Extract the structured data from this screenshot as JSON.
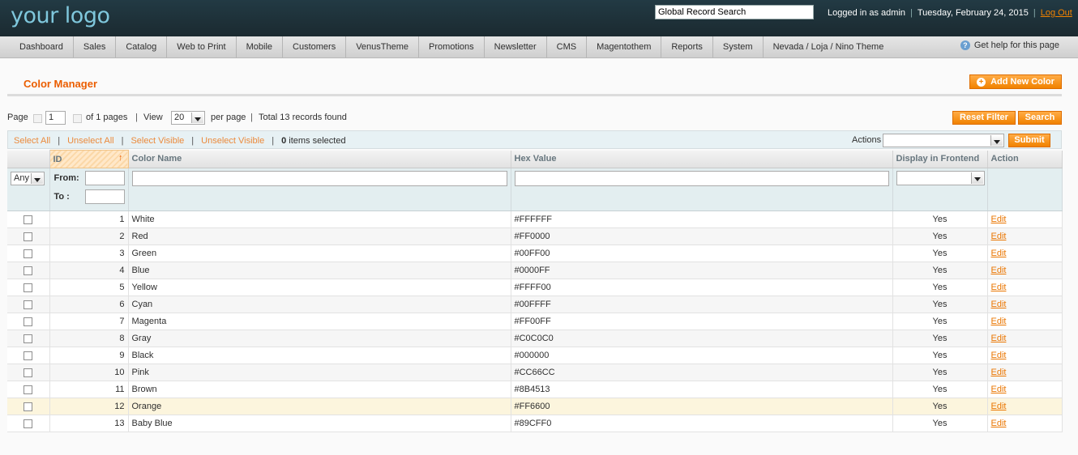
{
  "header": {
    "logo": "your logo",
    "global_search_placeholder": "Global Record Search",
    "logged_in": "Logged in as admin",
    "date": "Tuesday, February 24, 2015",
    "logout": "Log Out"
  },
  "nav": {
    "items": [
      "Dashboard",
      "Sales",
      "Catalog",
      "Web to Print",
      "Mobile",
      "Customers",
      "VenusTheme",
      "Promotions",
      "Newsletter",
      "CMS",
      "Magentothem",
      "Reports",
      "System",
      "Nevada / Loja / Nino Theme"
    ],
    "help": "Get help for this page"
  },
  "page": {
    "title": "Color Manager",
    "add_button": "Add New Color",
    "reset_filter": "Reset Filter",
    "search": "Search"
  },
  "pager": {
    "page_label": "Page",
    "page_value": "1",
    "of_pages": "of 1 pages",
    "view_label": "View",
    "per_page_value": "20",
    "per_page_label": "per page",
    "total": "Total 13 records found"
  },
  "massaction": {
    "select_all": "Select All",
    "unselect_all": "Unselect All",
    "select_visible": "Select Visible",
    "unselect_visible": "Unselect Visible",
    "selected_count": "0",
    "selected_label": "items selected",
    "actions_label": "Actions",
    "submit": "Submit"
  },
  "grid": {
    "columns": [
      "",
      "ID",
      "Color Name",
      "Hex Value",
      "Display in Frontend",
      "Action"
    ],
    "filter": {
      "any": "Any",
      "from": "From:",
      "to": "To :"
    },
    "rows": [
      {
        "id": "1",
        "name": "White",
        "hex": "#FFFFFF",
        "display": "Yes",
        "action": "Edit"
      },
      {
        "id": "2",
        "name": "Red",
        "hex": "#FF0000",
        "display": "Yes",
        "action": "Edit"
      },
      {
        "id": "3",
        "name": "Green",
        "hex": "#00FF00",
        "display": "Yes",
        "action": "Edit"
      },
      {
        "id": "4",
        "name": "Blue",
        "hex": "#0000FF",
        "display": "Yes",
        "action": "Edit"
      },
      {
        "id": "5",
        "name": "Yellow",
        "hex": "#FFFF00",
        "display": "Yes",
        "action": "Edit"
      },
      {
        "id": "6",
        "name": "Cyan",
        "hex": "#00FFFF",
        "display": "Yes",
        "action": "Edit"
      },
      {
        "id": "7",
        "name": "Magenta",
        "hex": "#FF00FF",
        "display": "Yes",
        "action": "Edit"
      },
      {
        "id": "8",
        "name": "Gray",
        "hex": "#C0C0C0",
        "display": "Yes",
        "action": "Edit"
      },
      {
        "id": "9",
        "name": "Black",
        "hex": "#000000",
        "display": "Yes",
        "action": "Edit"
      },
      {
        "id": "10",
        "name": "Pink",
        "hex": "#CC66CC",
        "display": "Yes",
        "action": "Edit"
      },
      {
        "id": "11",
        "name": "Brown",
        "hex": "#8B4513",
        "display": "Yes",
        "action": "Edit"
      },
      {
        "id": "12",
        "name": "Orange",
        "hex": "#FF6600",
        "display": "Yes",
        "action": "Edit"
      },
      {
        "id": "13",
        "name": "Baby Blue",
        "hex": "#89CFF0",
        "display": "Yes",
        "action": "Edit"
      }
    ]
  }
}
